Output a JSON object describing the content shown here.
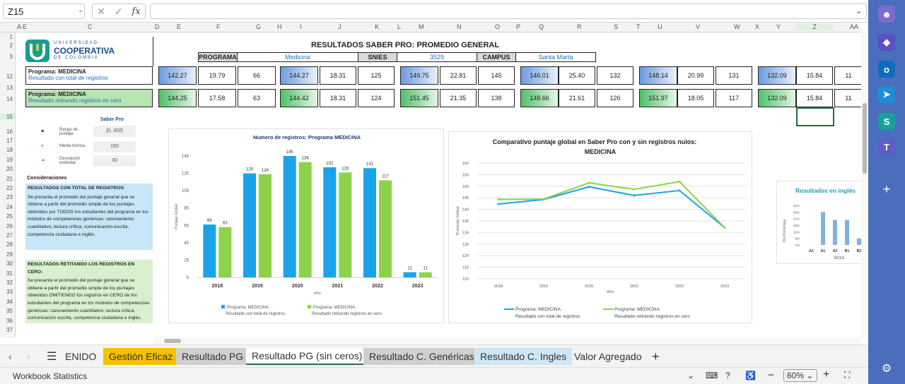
{
  "formula_bar": {
    "name_box": "Z15",
    "fx": "fx",
    "value": ""
  },
  "columns": [
    "A",
    "E",
    "C",
    "D",
    "E",
    "F",
    "G",
    "H",
    "I",
    "J",
    "K",
    "L",
    "M",
    "N",
    "O",
    "P",
    "Q",
    "R",
    "S",
    "T",
    "U",
    "V",
    "W",
    "X",
    "Y",
    "Z",
    "AA"
  ],
  "rows": [
    "1",
    "2",
    "3",
    "12",
    "13",
    "14",
    "15",
    "16",
    "17",
    "18",
    "19",
    "20",
    "21",
    "22",
    "23",
    "24",
    "25",
    "26",
    "27",
    "28",
    "29",
    "30",
    "31",
    "32",
    "33",
    "34",
    "35",
    "36",
    "37",
    "38"
  ],
  "logo": {
    "line1": "UNIVERSIDAD",
    "line2": "COOPERATIVA",
    "line3": "DE COLOMBIA"
  },
  "report": {
    "title": "RESULTADOS SABER PRO: PROMEDIO GENERAL",
    "programa_label": "PROGRAMA",
    "programa": "Medicina",
    "snies_label": "SNIES",
    "snies": "3529",
    "campus_label": "CAMPUS",
    "campus": "Santa Marta"
  },
  "row12": {
    "label1": "Programa: MEDICINA",
    "label2": "Resultado con total de registros",
    "values": [
      "142.27",
      "19.79",
      "66",
      "144.27",
      "18.31",
      "125",
      "149.75",
      "22.81",
      "145",
      "146.01",
      "25.40",
      "132",
      "148.14",
      "20.99",
      "131",
      "132.09",
      "15.84",
      "11"
    ]
  },
  "row14": {
    "label1": "Programa: MEDICINA",
    "label2": "Resultado retirando registros en cero",
    "values": [
      "144.25",
      "17.58",
      "63",
      "144.42",
      "18.31",
      "124",
      "151.45",
      "21.35",
      "138",
      "148.66",
      "21.61",
      "126",
      "151.97",
      "18.05",
      "117",
      "132.09",
      "15.84",
      "11"
    ]
  },
  "legend_box": {
    "brand": "Saber Pro",
    "rows": [
      {
        "label": "Rango de puntaje",
        "value": "[0, 300]"
      },
      {
        "label": "Media teórica",
        "value": "150"
      },
      {
        "label": "Desviación estándar",
        "value": "30"
      }
    ]
  },
  "considerations": {
    "title": "Consideraciones",
    "block1_title": "RESULTADOS CON TOTAL DE REGISTROS:",
    "block1_text": "Se presenta el promedio del puntaje general que se obtiene a partir del promedio simple de los puntajes obtenidos por TODOS los estudiantes del programa en los módulos de competencias genéricas: razonamiento cuantitativo, lectura crítica, comunicación escrita, competencia ciudadana e inglés.",
    "block2_title": "RESULTADOS RETITANDO LOS REGISTROS EN CERO:",
    "block2_text": "Se presenta el promedio del puntaje general que se obtiene a partir del promedio simple de los puntajes obtenidos OMITIENDO los registros en CERO de los estudiantes del programa en los módulos de competencias genéricas: razonamiento cuantitativo, lectura crítica, comunicación escrita, competencia ciudadana e inglés."
  },
  "chart_data": [
    {
      "type": "bar",
      "title": "Numero de registros: Programa MEDICINA",
      "xlabel": "Año",
      "ylabel": "Puntaje Global",
      "categories": [
        "2018",
        "2019",
        "2020",
        "2021",
        "2022",
        "2023"
      ],
      "yticks": [
        "5",
        "25",
        "45",
        "65",
        "85",
        "105",
        "125",
        "145"
      ],
      "ylim": [
        5,
        145
      ],
      "series": [
        {
          "name": "Programa: MEDICINA",
          "name2": "Resultado con total de registros",
          "color": "#1aa3e8",
          "values": [
            66,
            125,
            145,
            132,
            131,
            11
          ]
        },
        {
          "name": "Programa: MEDICINA",
          "name2": "Resultado retirando registros en cero",
          "color": "#8ed24a",
          "values": [
            63,
            124,
            138,
            126,
            117,
            11
          ]
        }
      ],
      "legend": "bottom"
    },
    {
      "type": "line",
      "title": "Comparativo puntaje global en Saber Pro  con y sin registros nulos:",
      "subtitle": "MEDICINA",
      "xlabel": "Año",
      "ylabel": "Promedio Global",
      "categories": [
        "2018",
        "2019",
        "2020",
        "2021",
        "2022",
        "2023"
      ],
      "yticks": [
        "110",
        "115",
        "120",
        "125",
        "130",
        "135",
        "140",
        "145",
        "150",
        "155",
        "160"
      ],
      "ylim": [
        110,
        160
      ],
      "series": [
        {
          "name": "Programa: MEDICINA",
          "name2": "Resultado con total de registros",
          "color": "#1aa3e8",
          "values": [
            142.27,
            144.27,
            149.75,
            146.01,
            148.14,
            132.09
          ]
        },
        {
          "name": "Programa: MEDICINA",
          "name2": "Resultado retirando registros en cero",
          "color": "#8ed24a",
          "values": [
            144.25,
            144.42,
            151.45,
            148.66,
            151.97,
            132.09
          ]
        }
      ],
      "legend": "bottom"
    },
    {
      "type": "bar",
      "title": "Resultados en inglés",
      "xlabel": "MCER",
      "ylabel": "(%) Porcentaje",
      "categories": [
        "-A1",
        "A1",
        "A2",
        "B1",
        "B2"
      ],
      "yticks": [
        "1%",
        "6%",
        "11%",
        "16%",
        "21%",
        "26%",
        "31%"
      ],
      "ylim": [
        1,
        31
      ],
      "series": [
        {
          "name": "",
          "color": "#7fb2e0",
          "values": [
            0,
            26,
            20,
            20,
            6
          ]
        }
      ]
    }
  ],
  "tabs": {
    "items": [
      "ENIDO",
      "Gestión Eficaz",
      "Resultado PG",
      "Resultado PG (sin ceros)",
      "Resultado C. Genéricas",
      "Resultado C. Ingles",
      "Valor Agregado"
    ],
    "active": "Resultado PG (sin ceros)",
    "colors": {
      "Gestión Eficaz": "#f5c000",
      "Resultado PG": "#cfcfcf",
      "Resultado C. Genéricas": "#cfcfcf",
      "Resultado C. Ingles": "#cfe6f6"
    }
  },
  "status": {
    "left": "Workbook Statistics",
    "zoom": "60%"
  }
}
